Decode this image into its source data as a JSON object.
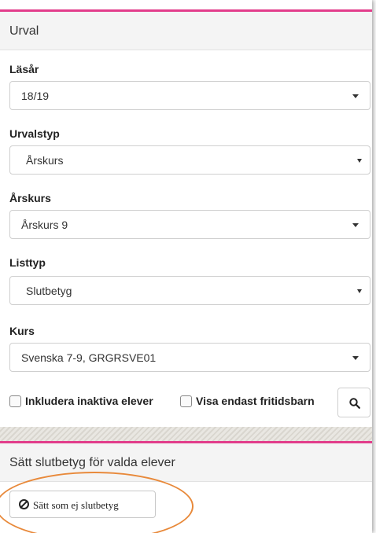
{
  "urval": {
    "title": "Urval",
    "lasar": {
      "label": "Läsår",
      "value": "18/19"
    },
    "urvalstyp": {
      "label": "Urvalstyp",
      "value": "Årskurs"
    },
    "arskurs": {
      "label": "Årskurs",
      "value": "Årskurs 9"
    },
    "listtyp": {
      "label": "Listtyp",
      "value": "Slutbetyg"
    },
    "kurs": {
      "label": "Kurs",
      "value": "Svenska 7-9, GRGRSVE01"
    },
    "include_inactive_label": "Inkludera inaktiva elever",
    "only_fritids_label": "Visa endast fritidsbarn",
    "search_icon": "search-icon"
  },
  "slutbetyg": {
    "title": "Sätt slutbetyg för valda elever",
    "button_label": "Sätt som ej slutbetyg",
    "button_icon": "ban-icon"
  },
  "colors": {
    "accent_rule": "#e23d8b",
    "highlight_ellipse": "#e8893a"
  }
}
